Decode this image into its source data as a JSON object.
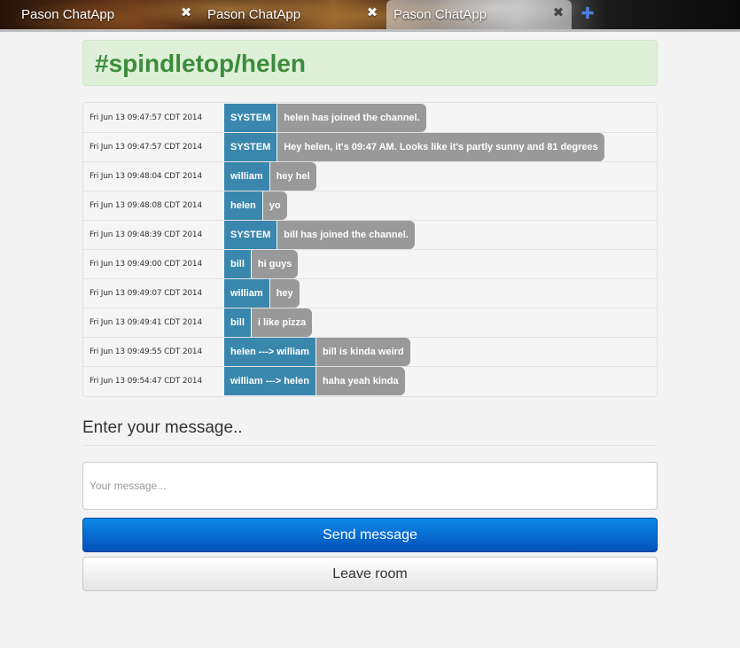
{
  "browser": {
    "tabs": [
      {
        "title": "Pason ChatApp",
        "active": false
      },
      {
        "title": "Pason ChatApp",
        "active": false
      },
      {
        "title": "Pason ChatApp",
        "active": true
      }
    ],
    "close_glyph": "✖",
    "new_tab_glyph": "✚"
  },
  "channel": {
    "title": "#spindletop/helen"
  },
  "messages": [
    {
      "time": "Fri Jun 13 09:47:57 CDT 2014",
      "user": "SYSTEM",
      "text": "helen has joined the channel."
    },
    {
      "time": "Fri Jun 13 09:47:57 CDT 2014",
      "user": "SYSTEM",
      "text": "Hey helen, it's 09:47 AM. Looks like it's partly sunny and 81 degrees"
    },
    {
      "time": "Fri Jun 13 09:48:04 CDT 2014",
      "user": "william",
      "text": "hey hel"
    },
    {
      "time": "Fri Jun 13 09:48:08 CDT 2014",
      "user": "helen",
      "text": "yo"
    },
    {
      "time": "Fri Jun 13 09:48:39 CDT 2014",
      "user": "SYSTEM",
      "text": "bill has joined the channel."
    },
    {
      "time": "Fri Jun 13 09:49:00 CDT 2014",
      "user": "bill",
      "text": "hi guys"
    },
    {
      "time": "Fri Jun 13 09:49:07 CDT 2014",
      "user": "william",
      "text": "hey"
    },
    {
      "time": "Fri Jun 13 09:49:41 CDT 2014",
      "user": "bill",
      "text": "i like pizza"
    },
    {
      "time": "Fri Jun 13 09:49:55 CDT 2014",
      "user": "helen ---> william",
      "text": "bill is kinda weird"
    },
    {
      "time": "Fri Jun 13 09:54:47 CDT 2014",
      "user": "william ---> helen",
      "text": "haha yeah kinda"
    }
  ],
  "composer": {
    "title": "Enter your message..",
    "placeholder": "Your message...",
    "value": "",
    "send_label": "Send message",
    "leave_label": "Leave room"
  },
  "colors": {
    "user_badge": "#3a87ad",
    "message_bubble": "#999999",
    "header_bg": "#dff0d8",
    "header_text": "#3c8c3c",
    "send_button": "#0b6fd0"
  }
}
